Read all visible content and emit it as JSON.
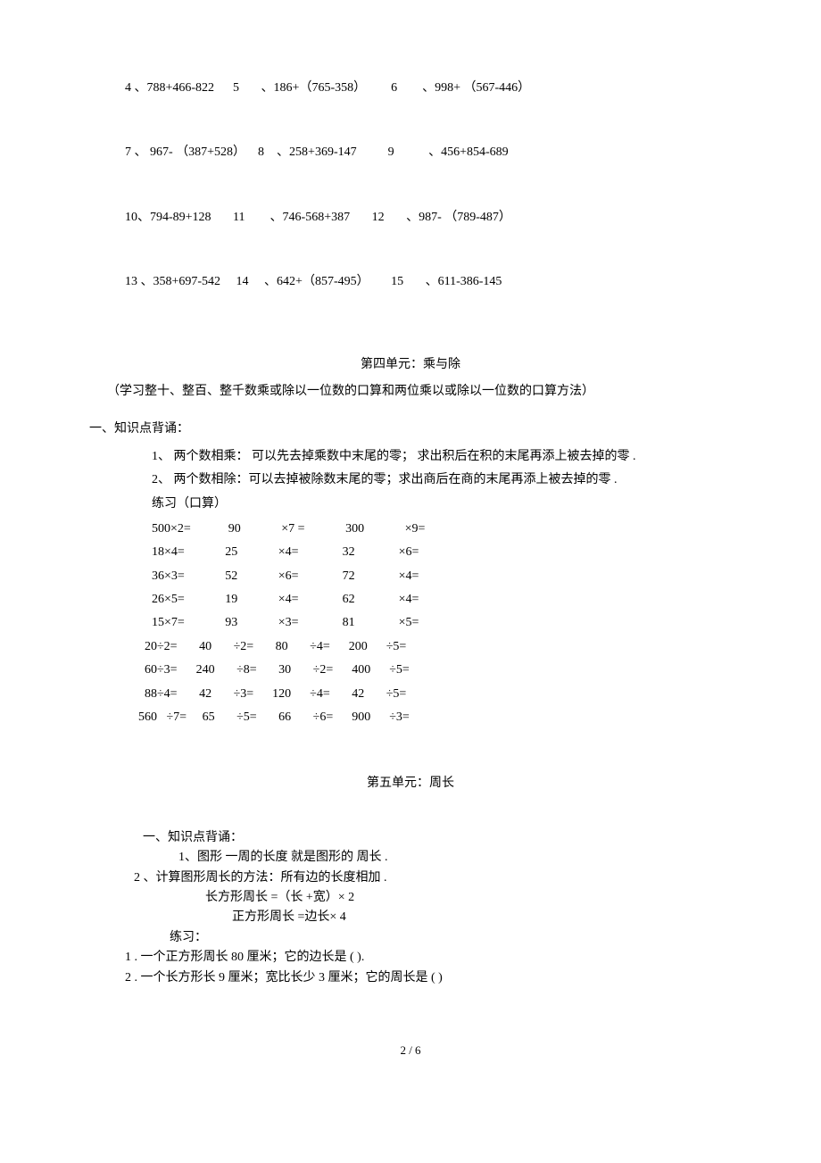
{
  "problems": {
    "row1": "4 、788+466-822      5       、186+（765-358）        6        、998+ （567-446）",
    "row2": "7 、 967- （387+528）    8    、258+369-147          9           、456+854-689",
    "row3": "10、794-89+128       11        、746-568+387       12       、987- （789-487）",
    "row4": "13 、358+697-542     14     、642+（857-495）       15       、611-386-145"
  },
  "unit4": {
    "title": "第四单元：乘与除",
    "subtitle": "（学习整十、整百、整千数乘或除以一位数的口算和两位乘以或除以一位数的口算方法）",
    "heading": "一、知识点背诵：",
    "point1": "1、  两个数相乘：  可以先去掉乘数中末尾的零；     求出积后在积的末尾再添上被去掉的零           .",
    "point2": "2、  两个数相除：可以去掉被除数末尾的零；求出商后在商的末尾再添上被去掉的零                  .",
    "practice_label": "练习（口算）",
    "mul_rows": [
      "500×2=            90             ×7 =             300             ×9=",
      "18×4=             25             ×4=              32              ×6=",
      "36×3=             52             ×6=              72              ×4=",
      "26×5=             19             ×4=              62              ×4=",
      "15×7=             93             ×3=              81              ×5="
    ],
    "div_rows": [
      "  20÷2=       40       ÷2=       80       ÷4=      200      ÷5=",
      "  60÷3=      240       ÷8=       30       ÷2=      400      ÷5=",
      "  88÷4=       42       ÷3=      120      ÷4=       42       ÷5=",
      "560   ÷7=     65       ÷5=       66       ÷6=      900      ÷3="
    ]
  },
  "unit5": {
    "title": "第五单元：周长",
    "heading": "一、知识点背诵：",
    "p1": "1、图形 一周的长度  就是图形的   周长 .",
    "p2": "2         、计算图形周长的方法：所有边的长度相加         .",
    "p3": "长方形周长  =（长 +宽）× 2",
    "p4": "正方形周长  =边长× 4",
    "practice_label": "练习：",
    "q1": "1       .  一个正方形周长    80 厘米；它的边长是   (                   ).",
    "q2": "2       .  一个长方形长    9 厘米；宽比长少    3 厘米；它的周长是   (                            )"
  },
  "footer": "2 / 6"
}
